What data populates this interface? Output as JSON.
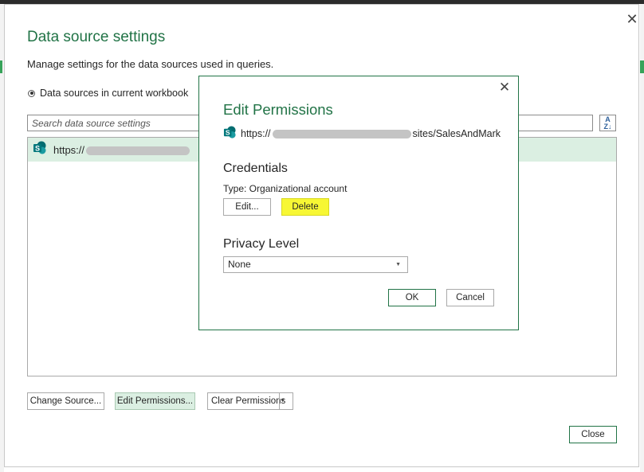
{
  "outer": {
    "title": "Data source settings",
    "subtitle": "Manage settings for the data sources used in queries.",
    "radio_label": "Data sources in current workbook",
    "search_placeholder": "Search data source settings",
    "sort_icon": "sort-az-icon",
    "list_items": [
      {
        "url_prefix": "https://",
        "icon": "sharepoint-icon"
      }
    ],
    "buttons": {
      "change_source": "Change Source...",
      "edit_permissions": "Edit Permissions...",
      "clear_permissions": "Clear Permissions",
      "close": "Close"
    }
  },
  "dialog": {
    "title": "Edit Permissions",
    "url_prefix": "https://",
    "url_suffix": "sites/SalesAndMark",
    "credentials_heading": "Credentials",
    "credentials_type": "Type: Organizational account",
    "edit_label": "Edit...",
    "delete_label": "Delete",
    "privacy_heading": "Privacy Level",
    "privacy_value": "None",
    "ok_label": "OK",
    "cancel_label": "Cancel"
  },
  "colors": {
    "accent": "#217346",
    "selection": "#dbefe2",
    "highlight": "#f7f734"
  }
}
